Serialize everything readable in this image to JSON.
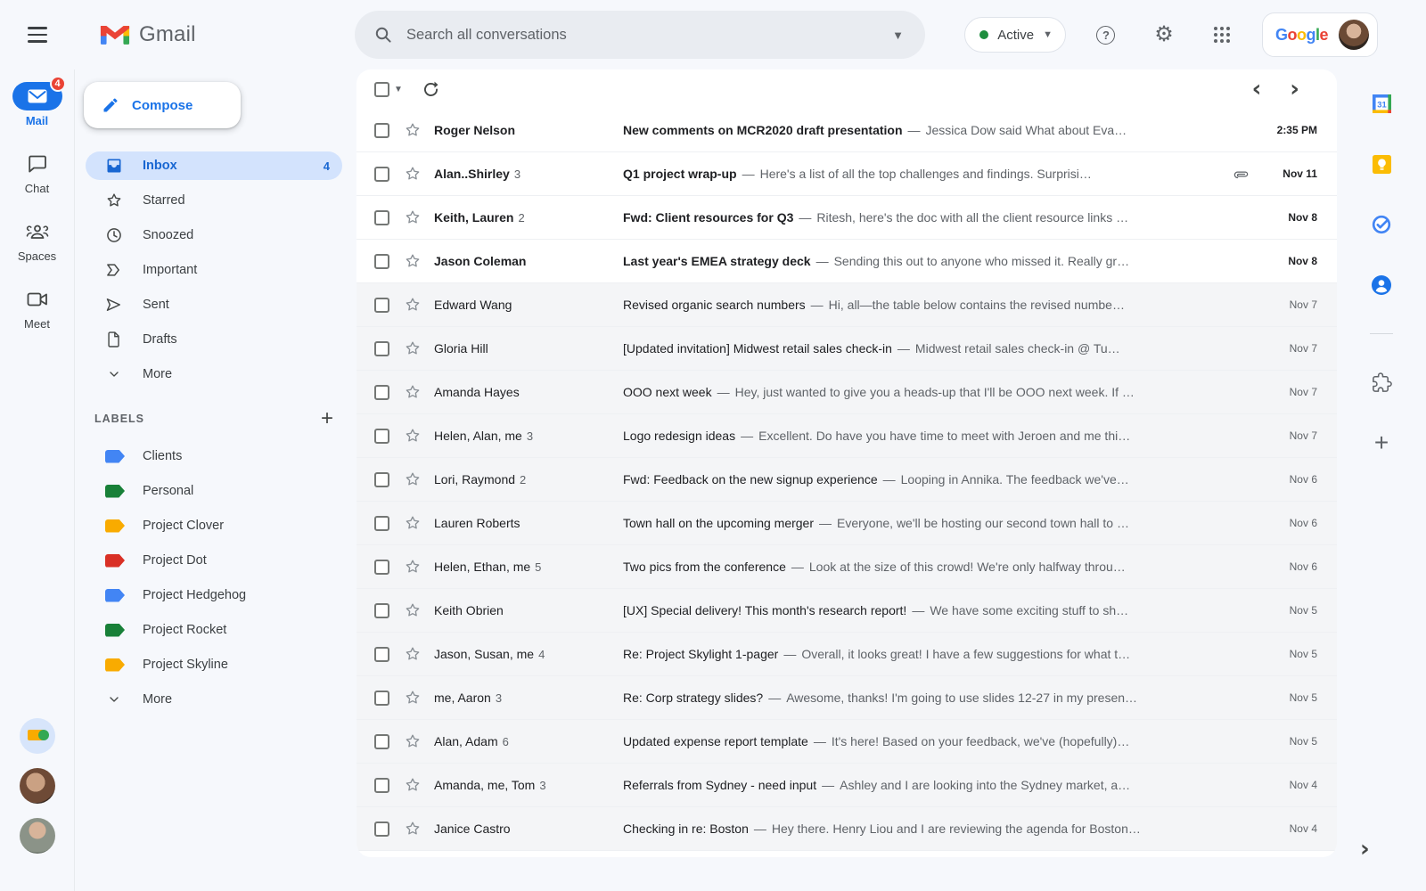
{
  "topbar": {
    "brand": "Gmail",
    "search_placeholder": "Search all conversations",
    "status_label": "Active",
    "google_letters": [
      {
        "ch": "G",
        "color": "#4285F4"
      },
      {
        "ch": "o",
        "color": "#EA4335"
      },
      {
        "ch": "o",
        "color": "#FBBC05"
      },
      {
        "ch": "g",
        "color": "#4285F4"
      },
      {
        "ch": "l",
        "color": "#34A853"
      },
      {
        "ch": "e",
        "color": "#EA4335"
      }
    ]
  },
  "colors": {
    "accent_blue": "#1a73e8",
    "selected_pill": "#d3e3fd",
    "badge_red": "#ea4335",
    "active_green": "#1e8e3e"
  },
  "rail": {
    "items": [
      {
        "label": "Mail",
        "badge": "4",
        "active": true
      },
      {
        "label": "Chat"
      },
      {
        "label": "Spaces"
      },
      {
        "label": "Meet"
      }
    ],
    "avatars": [
      {
        "name": "camera-toy-avatar"
      },
      {
        "name": "woman-avatar"
      },
      {
        "name": "man-avatar"
      }
    ]
  },
  "sidebar": {
    "compose_label": "Compose",
    "items": [
      {
        "label": "Inbox",
        "count": "4",
        "icon": "inbox",
        "selected": true
      },
      {
        "label": "Starred",
        "icon": "star"
      },
      {
        "label": "Snoozed",
        "icon": "clock"
      },
      {
        "label": "Important",
        "icon": "important"
      },
      {
        "label": "Sent",
        "icon": "send"
      },
      {
        "label": "Drafts",
        "icon": "draft"
      },
      {
        "label": "More",
        "icon": "chevron-down"
      }
    ],
    "labels_header": "LABELS",
    "labels": [
      {
        "name": "Clients",
        "color": "#4285f4"
      },
      {
        "name": "Personal",
        "color": "#188038"
      },
      {
        "name": "Project Clover",
        "color": "#f9ab00"
      },
      {
        "name": "Project Dot",
        "color": "#d93025"
      },
      {
        "name": "Project Hedgehog",
        "color": "#4285f4"
      },
      {
        "name": "Project Rocket",
        "color": "#188038"
      },
      {
        "name": "Project Skyline",
        "color": "#f9ab00"
      }
    ],
    "labels_more": "More"
  },
  "list": {
    "separator": "—",
    "rows": [
      {
        "sender": "Roger Nelson",
        "subject": "New comments on MCR2020 draft presentation",
        "snippet": "Jessica Dow said What about Eva…",
        "date": "2:35 PM",
        "unread": true
      },
      {
        "sender": "Alan..Shirley",
        "count": "3",
        "subject": "Q1 project wrap-up",
        "snippet": "Here's a list of all the top challenges and findings. Surprisi…",
        "date": "Nov 11",
        "unread": true,
        "attachment": true
      },
      {
        "sender": "Keith, Lauren",
        "count": "2",
        "subject": "Fwd: Client resources for Q3",
        "snippet": "Ritesh, here's the doc with all the client resource links …",
        "date": "Nov 8",
        "unread": true
      },
      {
        "sender": "Jason Coleman",
        "subject": "Last year's EMEA strategy deck",
        "snippet": "Sending this out to anyone who missed it. Really gr…",
        "date": "Nov 8",
        "unread": true
      },
      {
        "sender": "Edward Wang",
        "subject": "Revised organic search numbers",
        "snippet": "Hi, all—the table below contains the revised numbe…",
        "date": "Nov 7"
      },
      {
        "sender": "Gloria Hill",
        "subject": "[Updated invitation] Midwest retail sales check-in",
        "snippet": "Midwest retail sales check-in @ Tu…",
        "date": "Nov 7"
      },
      {
        "sender": "Amanda Hayes",
        "subject": "OOO next week",
        "snippet": "Hey, just wanted to give you a heads-up that I'll be OOO next week. If …",
        "date": "Nov 7"
      },
      {
        "sender": "Helen, Alan, me",
        "count": "3",
        "subject": "Logo redesign ideas",
        "snippet": "Excellent. Do have you have time to meet with Jeroen and me thi…",
        "date": "Nov 7"
      },
      {
        "sender": "Lori, Raymond",
        "count": "2",
        "subject": "Fwd: Feedback on the new signup experience",
        "snippet": "Looping in Annika. The feedback we've…",
        "date": "Nov 6"
      },
      {
        "sender": "Lauren Roberts",
        "subject": "Town hall on the upcoming merger",
        "snippet": "Everyone, we'll be hosting our second town hall to …",
        "date": "Nov 6"
      },
      {
        "sender": "Helen, Ethan, me",
        "count": "5",
        "subject": "Two pics from the conference",
        "snippet": "Look at the size of this crowd! We're only halfway throu…",
        "date": "Nov 6"
      },
      {
        "sender": "Keith Obrien",
        "subject": "[UX] Special delivery! This month's research report!",
        "snippet": "We have some exciting stuff to sh…",
        "date": "Nov 5"
      },
      {
        "sender": "Jason, Susan, me",
        "count": "4",
        "subject": "Re: Project Skylight 1-pager",
        "snippet": "Overall, it looks great! I have a few suggestions for what t…",
        "date": "Nov 5"
      },
      {
        "sender": "me, Aaron",
        "count": "3",
        "subject": "Re: Corp strategy slides?",
        "snippet": "Awesome, thanks! I'm going to use slides 12-27 in my presen…",
        "date": "Nov 5"
      },
      {
        "sender": "Alan, Adam",
        "count": "6",
        "subject": "Updated expense report template",
        "snippet": "It's here! Based on your feedback, we've (hopefully)…",
        "date": "Nov 5"
      },
      {
        "sender": "Amanda, me, Tom",
        "count": "3",
        "subject": "Referrals from Sydney - need input",
        "snippet": "Ashley and I are looking into the Sydney market, a…",
        "date": "Nov 4"
      },
      {
        "sender": "Janice Castro",
        "subject": "Checking in re: Boston",
        "snippet": "Hey there. Henry Liou and I are reviewing the agenda for Boston…",
        "date": "Nov 4"
      }
    ]
  },
  "side_panel": {
    "icons": [
      {
        "name": "google-calendar-icon"
      },
      {
        "name": "google-keep-icon"
      },
      {
        "name": "google-tasks-icon"
      },
      {
        "name": "google-contacts-icon"
      },
      {
        "name": "get-add-ons-icon"
      },
      {
        "name": "add-panel-icon"
      }
    ]
  }
}
